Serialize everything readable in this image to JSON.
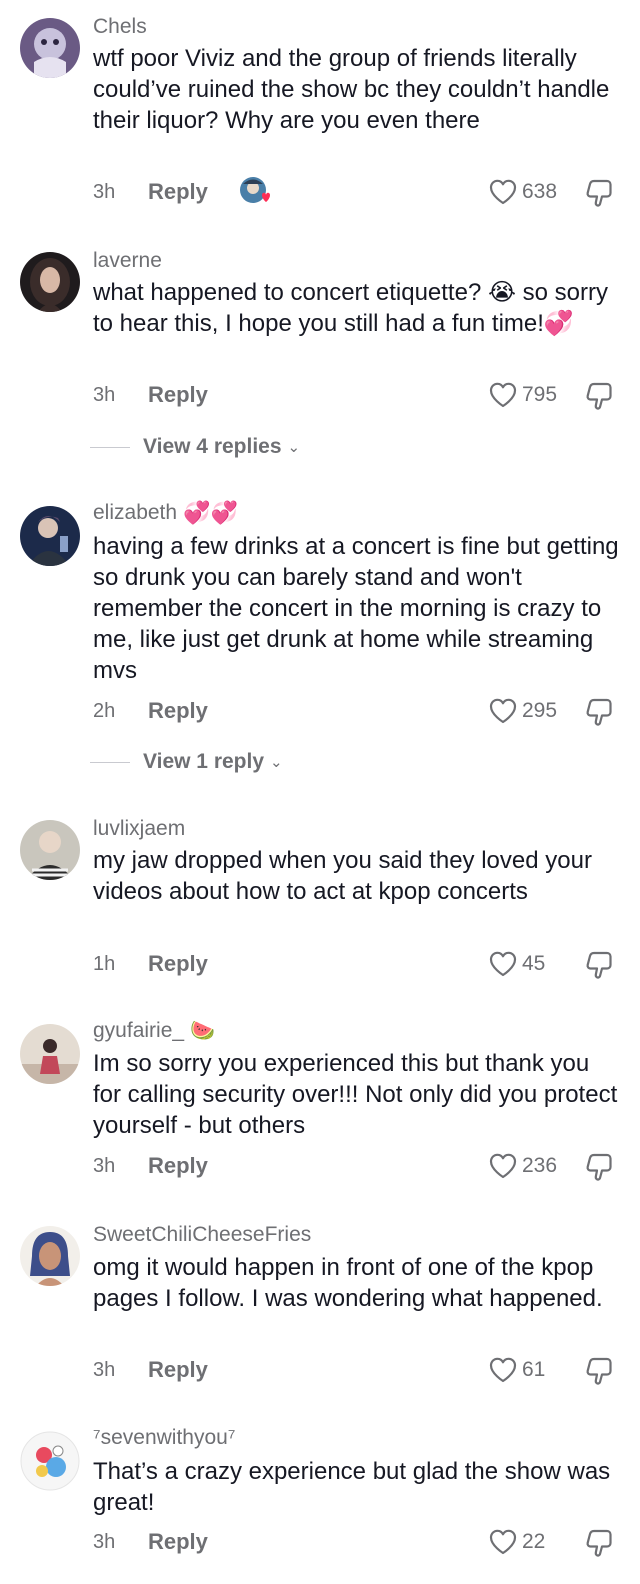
{
  "comments": [
    {
      "username": "Chels",
      "text": "wtf poor Viviz and the group of friends literally could’ve ruined the show bc they couldn’t handle their liquor? Why are you even there",
      "time": "3h",
      "reply": "Reply",
      "likes": "638",
      "creator_liked": true
    },
    {
      "username": "laverne",
      "text": "what happened to concert etiquette? 😭 so sorry to hear this, I hope you still had a fun time!💞",
      "time": "3h",
      "reply": "Reply",
      "likes": "795",
      "view_replies": "View 4 replies"
    },
    {
      "username": "elizabeth",
      "username_emoji": "💞💞",
      "text": "having a few drinks at a concert is fine but getting so drunk you can barely stand and won't remember the concert in the morning is crazy to me, like just get drunk at home while streaming mvs",
      "time": "2h",
      "reply": "Reply",
      "likes": "295",
      "view_replies": "View 1 reply"
    },
    {
      "username": "luvlixjaem",
      "text": "my jaw dropped when you said they loved your videos about how to act at kpop concerts",
      "time": "1h",
      "reply": "Reply",
      "likes": "45"
    },
    {
      "username": "gyufairie_",
      "username_emoji": "🍉",
      "text": "Im so sorry you experienced this but thank you for calling security over!!! Not only did you protect yourself - but others",
      "time": "3h",
      "reply": "Reply",
      "likes": "236"
    },
    {
      "username": "SweetChiliCheeseFries",
      "text": "omg it would happen in front of one of the kpop pages I follow. I was wondering what happened.",
      "time": "3h",
      "reply": "Reply",
      "likes": "61"
    },
    {
      "username": "⁷sevenwithyou⁷",
      "text": "That’s a crazy experience but glad the show was great!",
      "time": "3h",
      "reply": "Reply",
      "likes": "22"
    }
  ]
}
